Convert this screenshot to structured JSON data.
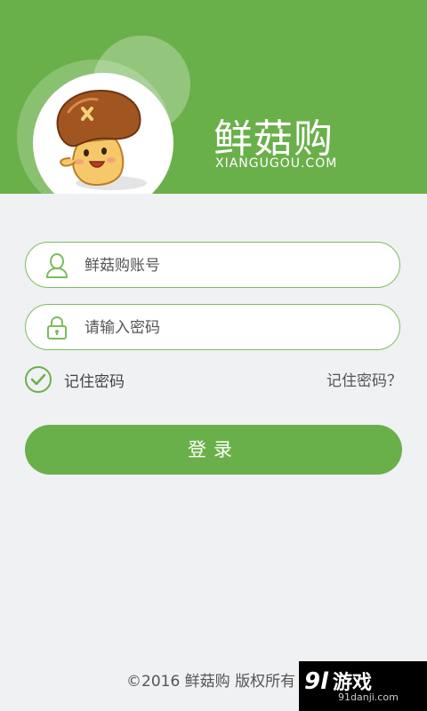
{
  "header": {
    "brand_name": "鲜菇购",
    "brand_domain": "XIANGUGOU.COM"
  },
  "login_form": {
    "account_placeholder": "鲜菇购账号",
    "password_placeholder": "请输入密码",
    "remember_label": "记住密码",
    "remember_checked": true,
    "forgot_label": "记住密码？",
    "login_label": "登录"
  },
  "footer": {
    "copyright": "©2016 鲜菇购 版权所有"
  },
  "watermark": {
    "mark": "9l",
    "main": "游戏",
    "sub": "91danji.com"
  },
  "colors": {
    "accent": "#6ab04a",
    "background": "#f0f1f3",
    "field_border": "#7cbc5c"
  },
  "icons": {
    "account": "user-outline-icon",
    "password": "lock-icon",
    "remember": "check-circle-icon",
    "mascot": "mushroom-mascot"
  }
}
